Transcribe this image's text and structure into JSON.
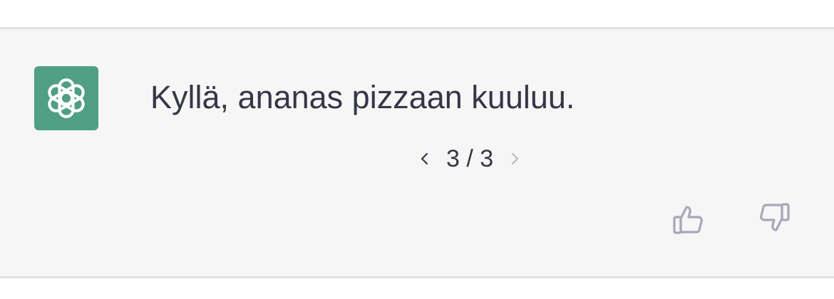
{
  "message": {
    "text": "Kyllä, ananas pizzaan kuuluu."
  },
  "pager": {
    "label": "3 / 3",
    "prev_icon": "chevron-left-icon",
    "next_icon": "chevron-right-icon"
  },
  "avatar": {
    "icon": "openai-logo-icon",
    "color": "#4f9f84"
  },
  "feedback": {
    "up_icon": "thumbs-up-icon",
    "down_icon": "thumbs-down-icon"
  },
  "colors": {
    "row_background": "#f6f6f6",
    "divider": "#e2e2e5",
    "text": "#353746",
    "icon_muted": "#a8a7b8"
  }
}
